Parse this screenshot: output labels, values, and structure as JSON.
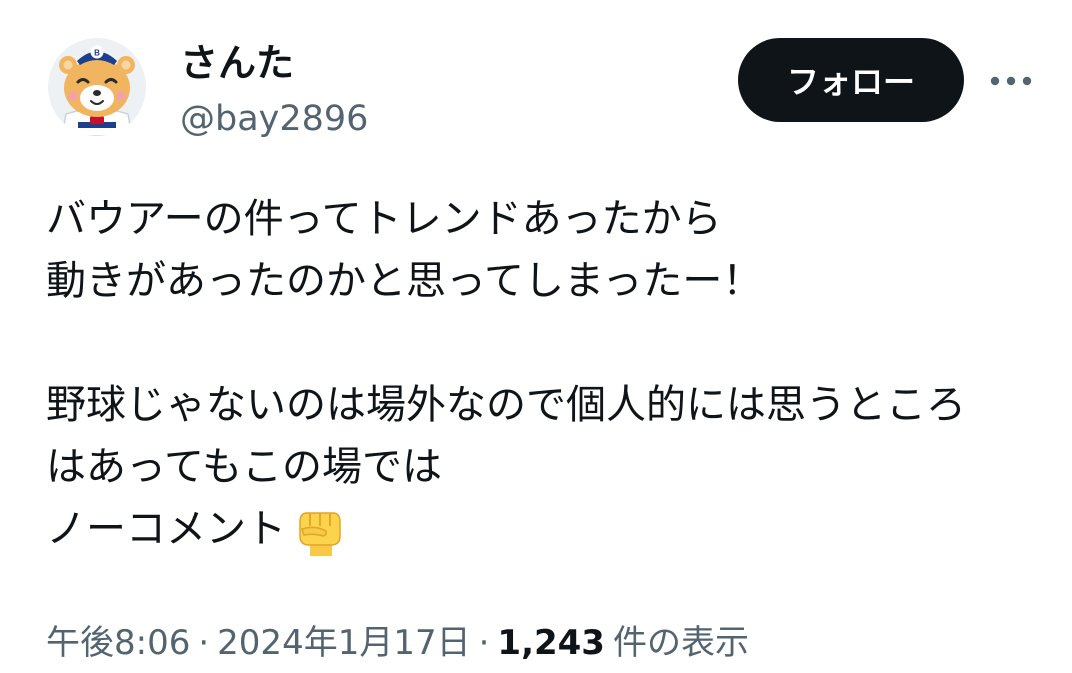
{
  "author": {
    "display_name": "さんた",
    "handle": "@bay2896",
    "avatar_icon": "mascot-avatar-icon"
  },
  "actions": {
    "follow_label": "フォロー",
    "more_icon": "more-horizontal-icon"
  },
  "tweet": {
    "paragraph1": {
      "line1": "バウアーの件ってトレンドあったから",
      "line2": "動きがあったのかと思ってしまったー！"
    },
    "paragraph2": {
      "line1": "野球じゃないのは場外なので個人的には思うところ",
      "line2": "はあってもこの場では",
      "line3": "ノーコメント"
    },
    "emoji": "raised-fist-emoji"
  },
  "meta": {
    "time": "午後8:06",
    "separator": "·",
    "date": "2024年1月17日",
    "view_count": "1,243",
    "views_label": "件の表示"
  },
  "colors": {
    "text_primary": "#0f1419",
    "text_secondary": "#536471",
    "button_bg": "#0f1419",
    "button_text": "#ffffff",
    "background": "#ffffff"
  }
}
